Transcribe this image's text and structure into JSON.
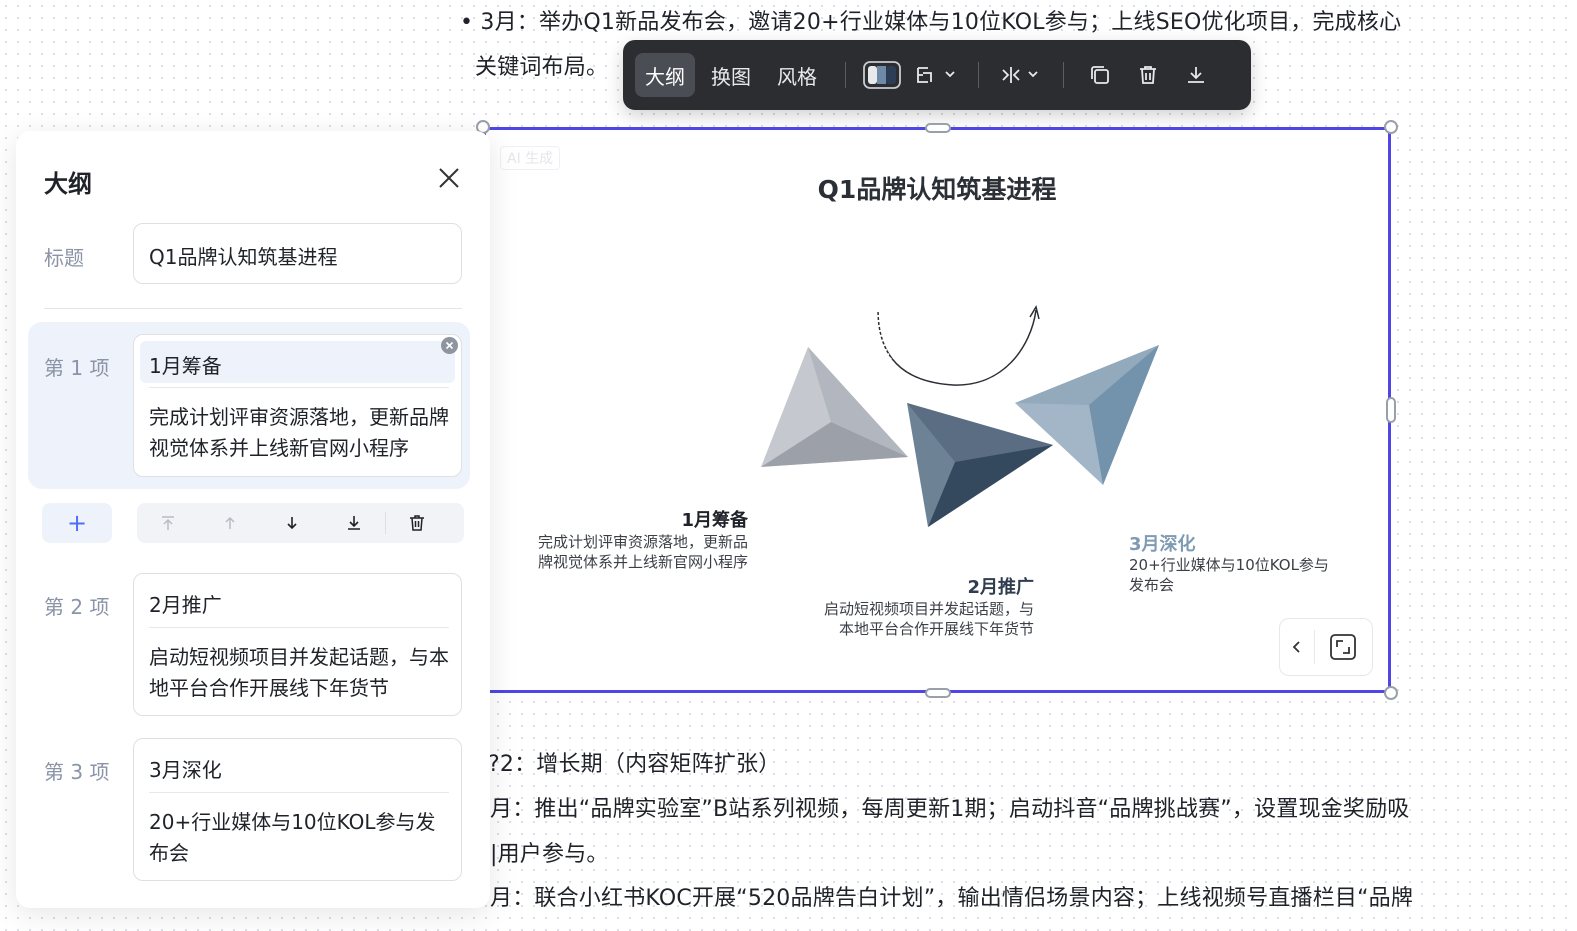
{
  "document": {
    "line1": "• 3月：举办Q1新品发布会，邀请20+行业媒体与10位KOL参与；上线SEO优化项目，完成核心",
    "line2": "关键词布局。",
    "line3": "?2：增长期（内容矩阵扩张）",
    "line4": "月：推出“品牌实验室”B站系列视频，每周更新1期；启动抖音“品牌挑战赛”，设置现金奖励吸",
    "line5": "|用户参与。",
    "line6": "月：联合小红书KOC开展“520品牌告白计划”，输出情侣场景内容；上线视频号直播栏目“品牌"
  },
  "toolbar": {
    "outline_label": "大纲",
    "swap_image_label": "换图",
    "style_label": "风格",
    "icons": [
      "color-scheme-icon",
      "layout-icon",
      "align-icon",
      "duplicate-icon",
      "delete-icon",
      "download-icon"
    ]
  },
  "canvas": {
    "ai_tag": "AI 生成",
    "chart_title": "Q1品牌认知筑基进程",
    "steps": [
      {
        "title": "1月筹备",
        "desc": "完成计划评审资源落地，更新品牌视觉体系并上线新官网小程序",
        "color": "#2b2f36"
      },
      {
        "title": "2月推广",
        "desc": "启动短视频项目并发起话题，与本地平台合作开展线下年货节",
        "color": "#2f3d4f"
      },
      {
        "title": "3月深化",
        "desc": "20+行业媒体与10位KOL参与发布会",
        "color": "#7f9ab3"
      }
    ],
    "arrow_colors": [
      "#b8bcc4",
      "#3e5064",
      "#8ba4ba"
    ]
  },
  "outline": {
    "title": "大纲",
    "title_label": "标题",
    "title_value": "Q1品牌认知筑基进程",
    "items": [
      {
        "label": "第 1 项",
        "title": "1月筹备",
        "desc": "完成计划评审资源落地，更新品牌视觉体系并上线新官网小程序"
      },
      {
        "label": "第 2 项",
        "title": "2月推广",
        "desc": "启动短视频项目并发起话题，与本地平台合作开展线下年货节"
      },
      {
        "label": "第 3 项",
        "title": "3月深化",
        "desc": "20+行业媒体与10位KOL参与发布会"
      }
    ],
    "add_label": "+"
  },
  "colors": {
    "accent": "#4f46e5",
    "panel_highlight": "#eef2fb",
    "toolbar_bg": "#2b2d31"
  }
}
